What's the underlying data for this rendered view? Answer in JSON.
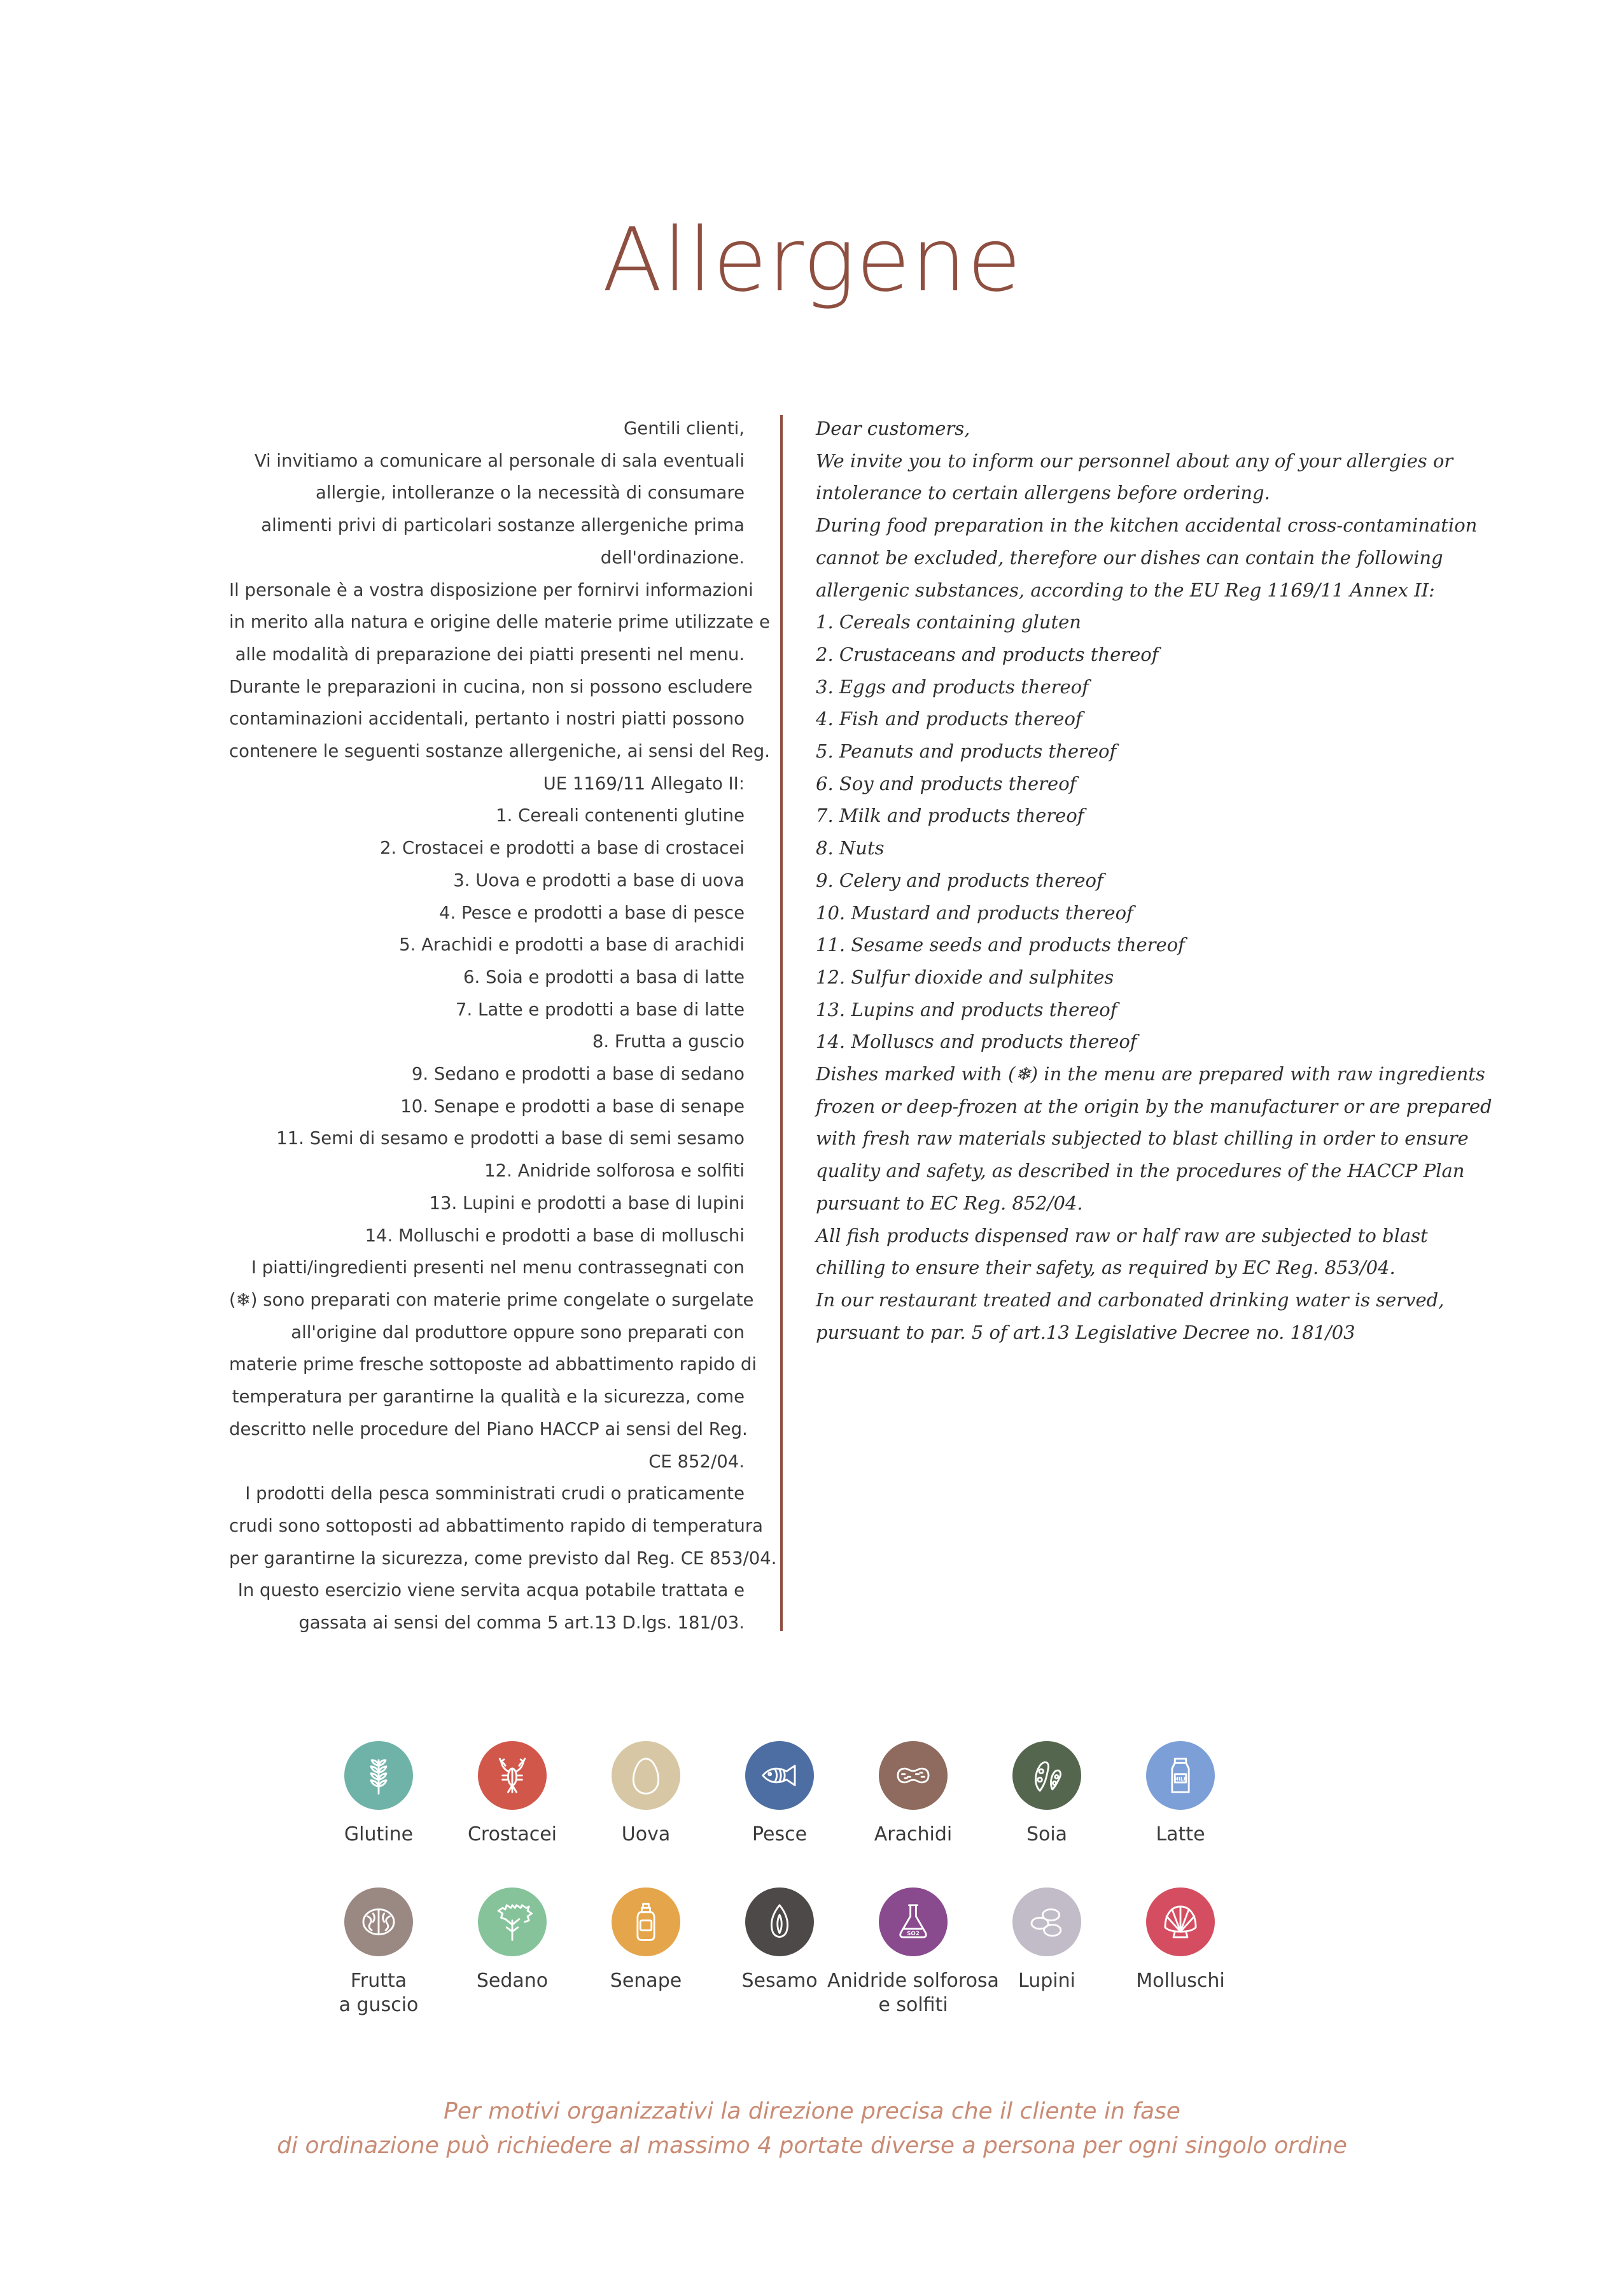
{
  "title": "Allergene",
  "italian": [
    "Gentili clienti,",
    "Vi invitiamo a comunicare al personale di sala eventuali",
    "allergie, intolleranze o la necessità di consumare",
    "alimenti privi di particolari sostanze allergeniche prima",
    "dell'ordinazione.",
    "Il personale è a vostra disposizione per fornirvi informazioni",
    "in merito alla natura e origine delle materie prime utilizzate e",
    "alle modalità di preparazione dei piatti presenti nel menu.",
    "Durante le preparazioni in cucina, non si possono escludere",
    "contaminazioni accidentali, pertanto i nostri piatti possono",
    "contenere le seguenti sostanze allergeniche, ai sensi del Reg.",
    "UE 1169/11 Allegato II:",
    "1. Cereali contenenti glutine",
    "2. Crostacei e prodotti a base di crostacei",
    "3. Uova e prodotti a base di uova",
    "4. Pesce e prodotti a base di pesce",
    "5. Arachidi e prodotti a base di arachidi",
    "6. Soia e prodotti a basa di latte",
    "7. Latte e prodotti a base di latte",
    "8. Frutta a guscio",
    "9. Sedano e prodotti a base di sedano",
    "10. Senape e prodotti a base di senape",
    "11. Semi di sesamo e prodotti a base di semi sesamo",
    "12. Anidride solforosa e solfiti",
    "13. Lupini e prodotti a base di lupini",
    "14. Molluschi e prodotti a base di molluschi",
    "I piatti/ingredienti presenti nel menu contrassegnati con",
    "(❄) sono preparati con materie prime congelate o surgelate",
    "all'origine dal produttore oppure sono preparati con",
    "materie prime fresche sottoposte ad abbattimento rapido di",
    "temperatura per garantirne la qualità e la sicurezza, come",
    "descritto nelle procedure del Piano HACCP ai sensi del Reg.",
    "CE 852/04.",
    "I prodotti della pesca somministrati crudi o praticamente",
    "crudi sono sottoposti ad abbattimento rapido di temperatura",
    "per garantirne la sicurezza, come previsto dal Reg. CE 853/04.",
    "In questo esercizio viene servita acqua potabile trattata e",
    "gassata ai sensi del comma 5 art.13 D.lgs. 181/03."
  ],
  "english": [
    "Dear customers,",
    "We invite you to inform our personnel about any of your allergies or",
    "intolerance to certain allergens before ordering.",
    "During food preparation in the kitchen accidental cross-contamination",
    "cannot be excluded, therefore our dishes can contain the following",
    "allergenic substances, according to the EU Reg 1169/11 Annex II:",
    "1. Cereals containing gluten",
    "2. Crustaceans and products thereof",
    "3. Eggs and products thereof",
    "4. Fish and products thereof",
    "5. Peanuts and products thereof",
    "6. Soy and products thereof",
    "7. Milk and products thereof",
    "8. Nuts",
    "9. Celery and products thereof",
    "10. Mustard and products thereof",
    "11. Sesame seeds and products thereof",
    "12. Sulfur dioxide and sulphites",
    "13. Lupins and products thereof",
    "14. Molluscs and products thereof",
    "Dishes marked with (❄) in the menu are prepared with raw ingredients",
    "frozen or deep-frozen at the origin by the manufacturer or are prepared",
    "with fresh raw materials subjected to blast chilling in order to ensure",
    "quality and safety, as described in the procedures of the HACCP Plan",
    "pursuant to EC Reg. 852/04.",
    "All fish products dispensed raw or half raw are subjected to blast",
    "chilling to ensure their safety, as required by EC Reg. 853/04.",
    "In our restaurant treated and carbonated drinking water is served,",
    "pursuant to par. 5 of art.13 Legislative Decree no. 181/03"
  ],
  "icons_row1": [
    {
      "label": "Glutine",
      "icon": "wheat-icon",
      "color": "#6fb3a8"
    },
    {
      "label": "Crostacei",
      "icon": "lobster-icon",
      "color": "#d2574b"
    },
    {
      "label": "Uova",
      "icon": "egg-icon",
      "color": "#d7c7a4"
    },
    {
      "label": "Pesce",
      "icon": "fish-icon",
      "color": "#4d6ea3"
    },
    {
      "label": "Arachidi",
      "icon": "peanut-icon",
      "color": "#8e6b5e"
    },
    {
      "label": "Soia",
      "icon": "soy-icon",
      "color": "#55664e"
    },
    {
      "label": "Latte",
      "icon": "milk-icon",
      "color": "#7c9fd8"
    }
  ],
  "icons_row2": [
    {
      "label": "Frutta\na guscio",
      "icon": "walnut-icon",
      "color": "#9a8882"
    },
    {
      "label": "Sedano",
      "icon": "celery-icon",
      "color": "#86c39a"
    },
    {
      "label": "Senape",
      "icon": "mustard-icon",
      "color": "#e5a54a"
    },
    {
      "label": "Sesamo",
      "icon": "sesame-icon",
      "color": "#4e4949"
    },
    {
      "label": "Anidride solforosa\ne solfiti",
      "icon": "flask-icon",
      "color": "#8a4a8e"
    },
    {
      "label": "Lupini",
      "icon": "lupin-icon",
      "color": "#c1bcc7"
    },
    {
      "label": "Molluschi",
      "icon": "shell-icon",
      "color": "#d54d60"
    }
  ],
  "milk_text": "MILK",
  "so2_text": "SO2",
  "note": [
    "Per motivi organizzativi la direzione precisa che il cliente in fase",
    "di ordinazione può richiedere al massimo  4 portate diverse a persona per ogni singolo ordine"
  ]
}
